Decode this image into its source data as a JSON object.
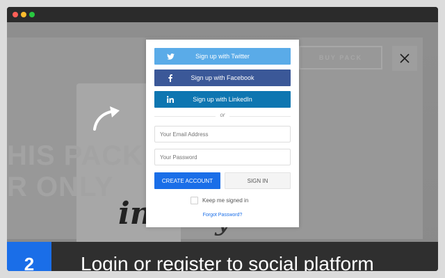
{
  "modal": {
    "twitter_label": "Sign up with Twitter",
    "facebook_label": "Sign up with Facebook",
    "linkedin_label": "Sign up with LinkedIn",
    "or_label": "or",
    "email_placeholder": "Your Email Address",
    "password_placeholder": "Your Password",
    "create_account_label": "CREATE ACCOUNT",
    "sign_in_label": "SIGN IN",
    "keep_signed_in_label": "Keep me signed in",
    "forgot_password_label": "Forgot Password?"
  },
  "background": {
    "line1": "HIS PACK",
    "line2": "R ONLY",
    "buy_label": "BUY PACK",
    "script_text": "in",
    "script_text2": "y"
  },
  "caption": {
    "step_number": "2",
    "text": "Login or register to social platform"
  },
  "colors": {
    "twitter": "#5aabe8",
    "facebook": "#3b5898",
    "linkedin": "#0e76b1",
    "accent": "#1a6ee8"
  },
  "icons": [
    "twitter-icon",
    "facebook-icon",
    "linkedin-icon",
    "curved-arrow-icon",
    "close-icon"
  ]
}
